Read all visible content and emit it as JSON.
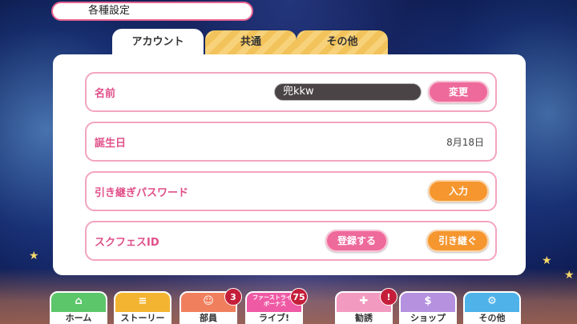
{
  "header": {
    "title": "各種設定"
  },
  "tabs": [
    {
      "label": "アカウント",
      "active": true
    },
    {
      "label": "共通",
      "active": false
    },
    {
      "label": "その他",
      "active": false
    }
  ],
  "account": {
    "name": {
      "label": "名前",
      "value": "兜kkw",
      "button": "変更"
    },
    "birthday": {
      "label": "誕生日",
      "value": "8月18日"
    },
    "password": {
      "label": "引き継ぎパスワード",
      "button": "入力"
    },
    "sif_id": {
      "label": "スクフェスID",
      "register_button": "登録する",
      "transfer_button": "引き継ぐ"
    }
  },
  "nav": {
    "items": [
      {
        "label": "ホーム",
        "icon": "home-icon",
        "color": "#5cc66a"
      },
      {
        "label": "ストーリー",
        "icon": "story-icon",
        "color": "#f3b531"
      },
      {
        "label": "部員",
        "icon": "members-icon",
        "color": "#f07f5e",
        "badge": "3"
      },
      {
        "label": "ライブ!",
        "icon": "live-icon",
        "color": "#ef5aa5",
        "badge": "75",
        "tag": "ファーストライブボーナス"
      },
      {
        "label": "勧誘",
        "icon": "scout-icon",
        "color": "#f39ac0",
        "badge": "!"
      },
      {
        "label": "ショップ",
        "icon": "shop-icon",
        "color": "#b591df"
      },
      {
        "label": "その他",
        "icon": "other-icon",
        "color": "#4fb2e8"
      }
    ]
  },
  "colors": {
    "accent_pink": "#ee6a9a",
    "accent_orange": "#f5962f",
    "row_border": "#f3a4c0"
  }
}
